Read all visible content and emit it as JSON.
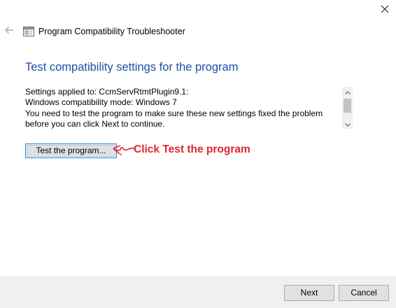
{
  "window": {
    "title": "Program Compatibility Troubleshooter",
    "icons": {
      "close": "close-icon",
      "back": "back-arrow-icon",
      "app": "troubleshooter-icon"
    }
  },
  "main": {
    "heading": "Test compatibility settings for the program",
    "settings_lines": [
      "Settings applied to: CcmServRtmtPlugin9.1:",
      "Windows compatibility mode: Windows 7",
      "You need to test the program to make sure these new settings fixed the problem",
      "before you can click Next to continue."
    ],
    "test_button_label": "Test the program..."
  },
  "annotation": {
    "text": "Click Test the program",
    "color": "#e0262e"
  },
  "footer": {
    "next_label": "Next",
    "cancel_label": "Cancel"
  },
  "colors": {
    "heading": "#1e4fa3",
    "focus_border": "#2b7bd4",
    "footer_bg": "#f0f0f0"
  }
}
